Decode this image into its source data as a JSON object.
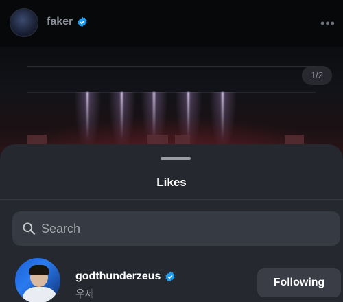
{
  "post": {
    "username": "faker",
    "page_indicator": "1/2"
  },
  "likes_sheet": {
    "title": "Likes",
    "search": {
      "placeholder": "Search",
      "value": ""
    },
    "users": [
      {
        "username": "godthunderzeus",
        "display_name": "우제",
        "verified": true,
        "button_label": "Following"
      }
    ]
  },
  "colors": {
    "verified_blue": "#1d9bf0",
    "sheet_bg": "#25282e",
    "button_bg": "#3a3d45"
  },
  "icons": [
    "more-dots-icon",
    "verified-badge-icon",
    "search-icon"
  ]
}
